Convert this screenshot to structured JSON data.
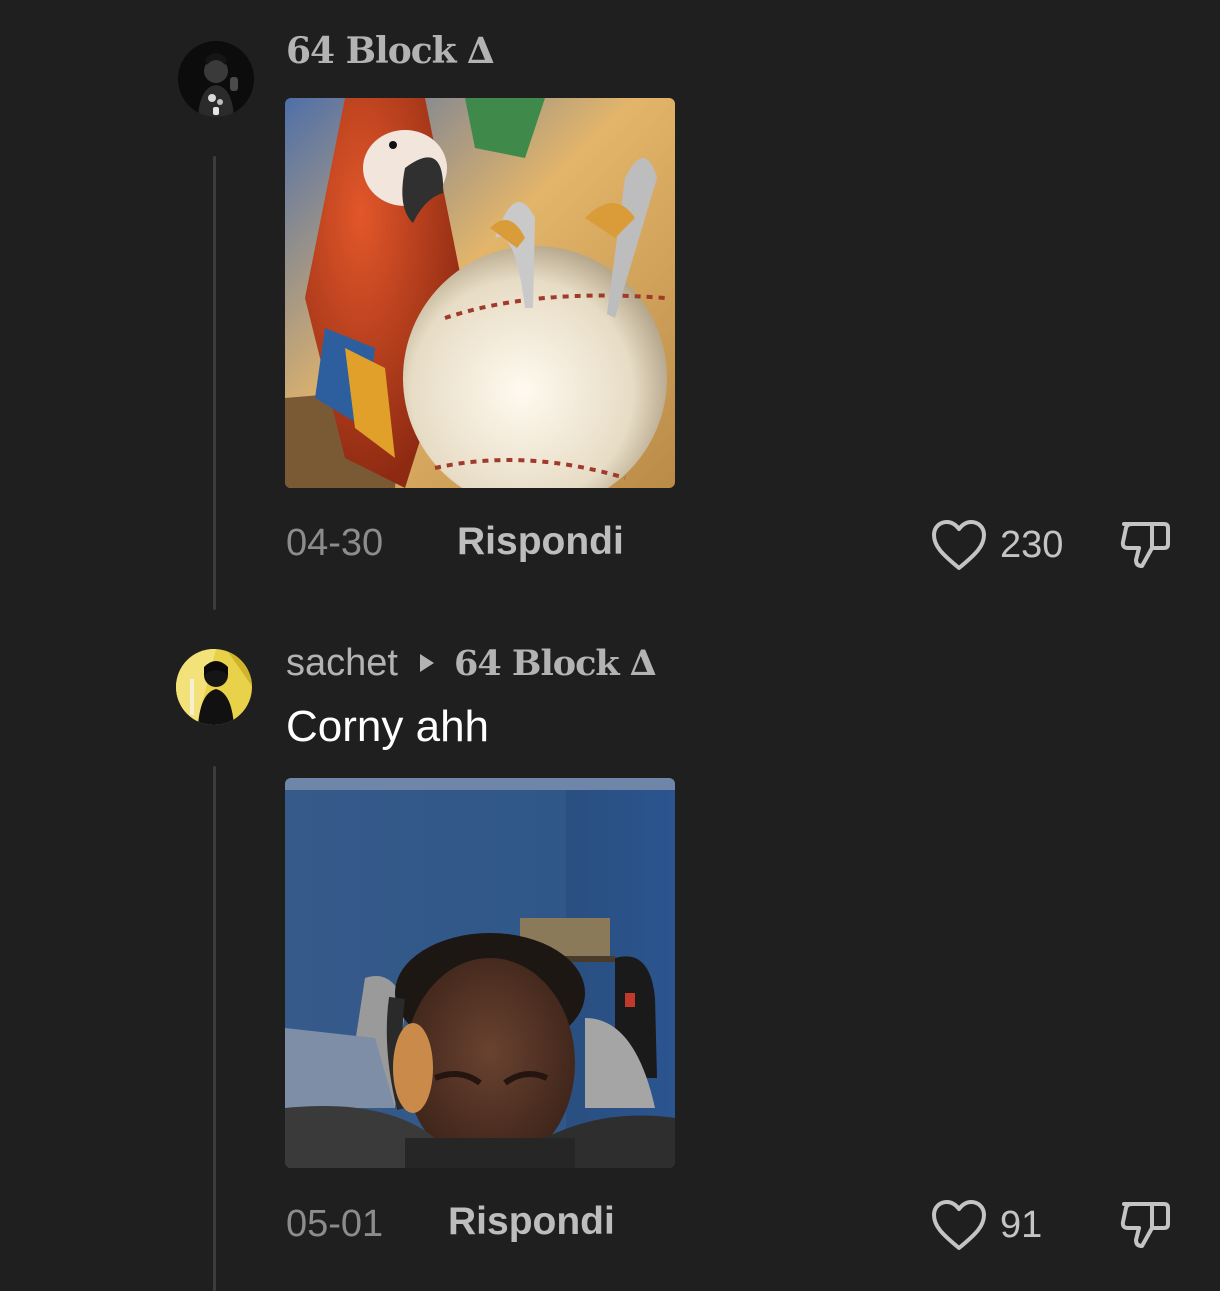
{
  "comments": [
    {
      "author": "64 Block ∆",
      "media_alt": "parrot-baseball-image",
      "date": "04-30",
      "reply_label": "Rispondi",
      "likes": "230"
    },
    {
      "author": "sachet",
      "reply_to": "64 Block ∆",
      "text": "Corny ahh",
      "media_alt": "man-laughing-headphones-image",
      "date": "05-01",
      "reply_label": "Rispondi",
      "likes": "91"
    }
  ],
  "icons": {
    "like": "heart-outline-icon",
    "dislike": "thumbs-down-outline-icon",
    "reply_to": "triangle-right-icon"
  },
  "colors": {
    "background": "#1f1f20",
    "username": "#b3b3b3",
    "text": "#ffffff",
    "meta": "#8c8c8c"
  }
}
